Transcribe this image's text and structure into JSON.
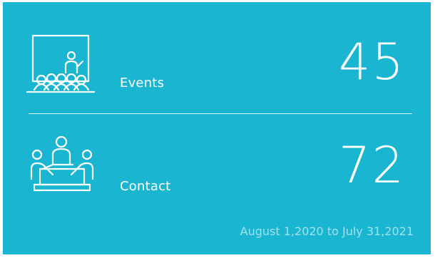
{
  "stats": [
    {
      "label": "Events",
      "value": "45",
      "icon": "presentation-audience-icon"
    },
    {
      "label": "Contact",
      "value": "72",
      "icon": "meeting-table-icon"
    }
  ],
  "date_range": "August 1,2020 to July 31,2021",
  "colors": {
    "background": "#19b5d1",
    "text": "#ffffff"
  }
}
